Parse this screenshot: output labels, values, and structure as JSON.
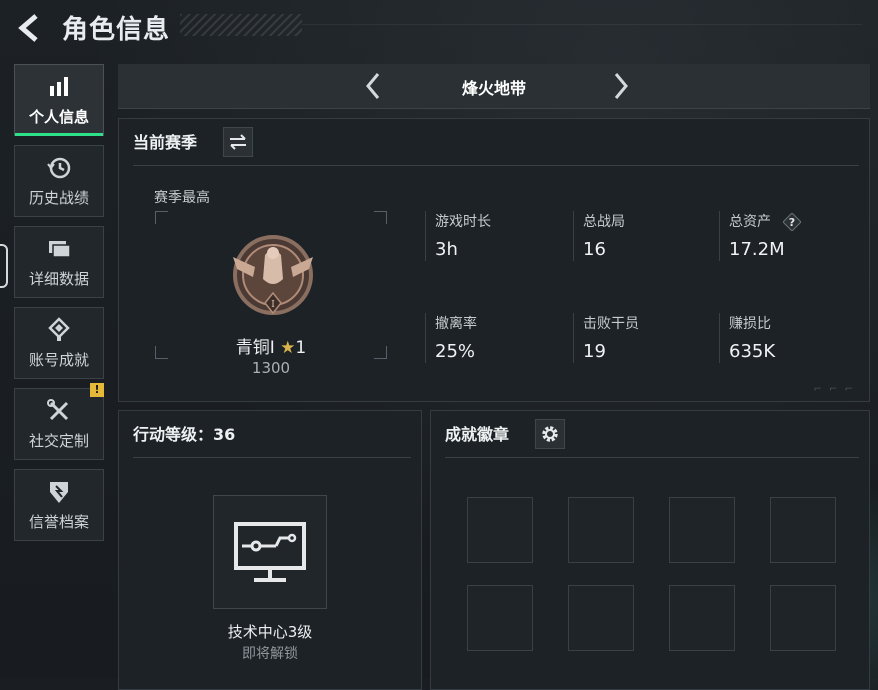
{
  "header": {
    "title": "角色信息"
  },
  "sidebar": {
    "items": [
      {
        "label": "个人信息",
        "icon": "bar-chart-icon",
        "active": true
      },
      {
        "label": "历史战绩",
        "icon": "history-icon"
      },
      {
        "label": "详细数据",
        "icon": "cards-icon"
      },
      {
        "label": "账号成就",
        "icon": "achievement-icon"
      },
      {
        "label": "社交定制",
        "icon": "tools-icon",
        "badge": "!"
      },
      {
        "label": "信誉档案",
        "icon": "credit-icon"
      }
    ]
  },
  "mode": {
    "name": "烽火地带"
  },
  "season": {
    "title": "当前赛季",
    "best_label": "赛季最高",
    "rank_name": "青铜I",
    "rank_star": "★",
    "rank_stars_count": "1",
    "rank_score": "1300",
    "stats": [
      {
        "label": "游戏时长",
        "value": "3h"
      },
      {
        "label": "总战局",
        "value": "16"
      },
      {
        "label": "总资产",
        "value": "17.2M",
        "help": "?"
      },
      {
        "label": "撤离率",
        "value": "25%"
      },
      {
        "label": "击败干员",
        "value": "19"
      },
      {
        "label": "赚损比",
        "value": "635K"
      }
    ]
  },
  "level": {
    "title": "行动等级：36",
    "tech_name": "技术中心3级",
    "tech_status": "即将解锁"
  },
  "badges": {
    "title": "成就徽章"
  },
  "colors": {
    "accent": "#2ee08a",
    "gold": "#d9b34c",
    "alert": "#e6b83a"
  }
}
